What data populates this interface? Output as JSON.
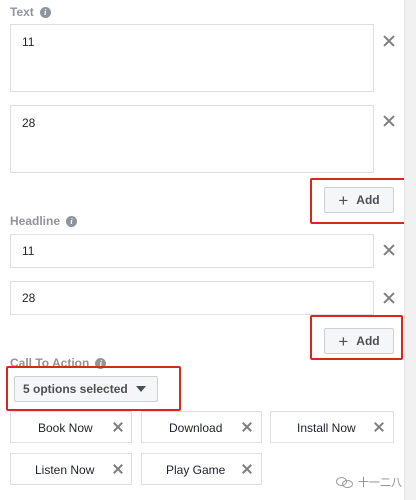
{
  "text_section": {
    "label": "Text",
    "fields": [
      {
        "value": "11"
      },
      {
        "value": "28"
      }
    ],
    "add_label": "Add"
  },
  "headline_section": {
    "label": "Headline",
    "fields": [
      {
        "value": "11"
      },
      {
        "value": "28"
      }
    ],
    "add_label": "Add"
  },
  "cta_section": {
    "label": "Call To Action",
    "dropdown_label": "5 options selected",
    "options": [
      {
        "label": "Book Now"
      },
      {
        "label": "Download"
      },
      {
        "label": "Install Now"
      },
      {
        "label": "Listen Now"
      },
      {
        "label": "Play Game"
      }
    ]
  },
  "watermark": {
    "text": "十一二八"
  },
  "colors": {
    "highlight": "#d8281e",
    "label_gray": "#90949c",
    "border": "#dddfe2"
  },
  "icons": [
    "info-icon",
    "close-icon",
    "plus-icon",
    "caret-down-icon",
    "wechat-logo"
  ]
}
